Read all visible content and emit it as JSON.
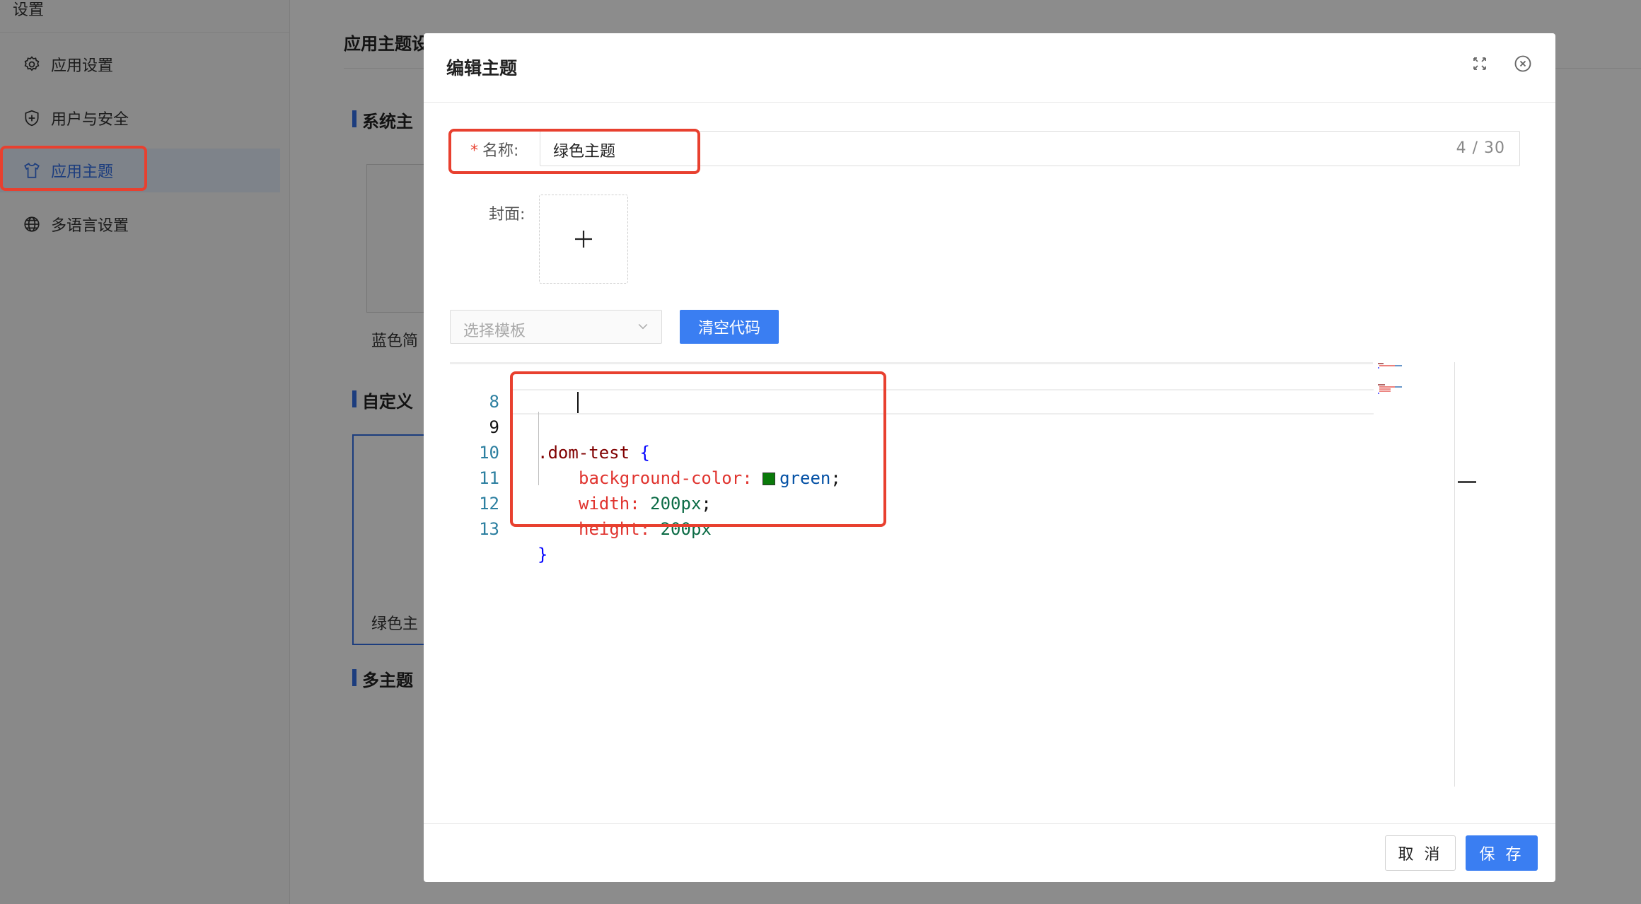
{
  "sidebar": {
    "title": "设置",
    "items": [
      {
        "label": "应用设置",
        "icon": "gear-icon"
      },
      {
        "label": "用户与安全",
        "icon": "shield-plus-icon"
      },
      {
        "label": "应用主题",
        "icon": "shirt-icon",
        "active": true
      },
      {
        "label": "多语言设置",
        "icon": "globe-icon"
      }
    ]
  },
  "main": {
    "title": "应用主题设",
    "sections": [
      {
        "title": "系统主"
      },
      {
        "title": "自定义"
      },
      {
        "title": "多主题"
      }
    ],
    "cards": [
      {
        "label": "蓝色简"
      },
      {
        "label": "绿色主"
      }
    ]
  },
  "modal": {
    "title": "编辑主题",
    "name_label": "名称:",
    "required_mark": "*",
    "name_value": "绿色主题",
    "name_count": "4 / 30",
    "cover_label": "封面:",
    "template_placeholder": "选择模板",
    "clear_button": "清空代码",
    "cancel_button": "取 消",
    "save_button": "保 存"
  },
  "editor": {
    "line_numbers": [
      "8",
      "9",
      "10",
      "11",
      "12",
      "13"
    ],
    "current_line": "9",
    "code": {
      "selector": ".dom-test",
      "open_brace": "{",
      "close_brace": "}",
      "props": [
        {
          "name": "background-color:",
          "value": "green",
          "end": ";"
        },
        {
          "name": "width:",
          "value": "200px",
          "end": ";"
        },
        {
          "name": "height:",
          "value": "200px",
          "end": ""
        }
      ]
    }
  },
  "colors": {
    "accent": "#3a7ef2",
    "highlight": "#e8402f",
    "swatch_green": "#0a7a0a"
  }
}
